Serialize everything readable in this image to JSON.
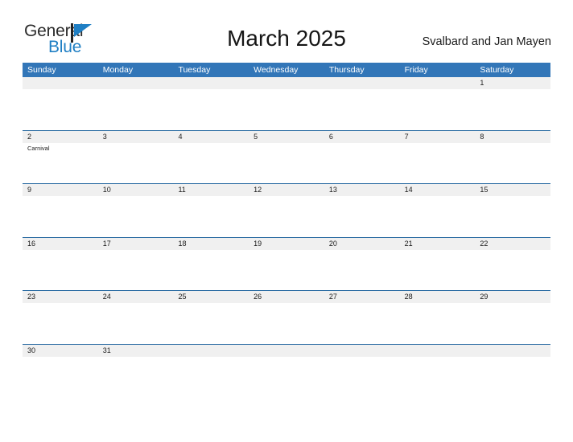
{
  "brand": {
    "name_part1": "General",
    "name_part2": "Blue",
    "flag_icon": "flag-icon",
    "accent_color": "#1f7fc4"
  },
  "header": {
    "month_title": "March 2025",
    "locale": "Svalbard and Jan Mayen"
  },
  "theme": {
    "header_blue": "#3276b8",
    "row_line_blue": "#2b6ca3",
    "number_band_gray": "#f0f0f0"
  },
  "calendar": {
    "day_headers": [
      "Sunday",
      "Monday",
      "Tuesday",
      "Wednesday",
      "Thursday",
      "Friday",
      "Saturday"
    ],
    "weeks": [
      {
        "days": [
          {
            "number": "",
            "events": []
          },
          {
            "number": "",
            "events": []
          },
          {
            "number": "",
            "events": []
          },
          {
            "number": "",
            "events": []
          },
          {
            "number": "",
            "events": []
          },
          {
            "number": "",
            "events": []
          },
          {
            "number": "1",
            "events": []
          }
        ]
      },
      {
        "days": [
          {
            "number": "2",
            "events": [
              "Carnival"
            ]
          },
          {
            "number": "3",
            "events": []
          },
          {
            "number": "4",
            "events": []
          },
          {
            "number": "5",
            "events": []
          },
          {
            "number": "6",
            "events": []
          },
          {
            "number": "7",
            "events": []
          },
          {
            "number": "8",
            "events": []
          }
        ]
      },
      {
        "days": [
          {
            "number": "9",
            "events": []
          },
          {
            "number": "10",
            "events": []
          },
          {
            "number": "11",
            "events": []
          },
          {
            "number": "12",
            "events": []
          },
          {
            "number": "13",
            "events": []
          },
          {
            "number": "14",
            "events": []
          },
          {
            "number": "15",
            "events": []
          }
        ]
      },
      {
        "days": [
          {
            "number": "16",
            "events": []
          },
          {
            "number": "17",
            "events": []
          },
          {
            "number": "18",
            "events": []
          },
          {
            "number": "19",
            "events": []
          },
          {
            "number": "20",
            "events": []
          },
          {
            "number": "21",
            "events": []
          },
          {
            "number": "22",
            "events": []
          }
        ]
      },
      {
        "days": [
          {
            "number": "23",
            "events": []
          },
          {
            "number": "24",
            "events": []
          },
          {
            "number": "25",
            "events": []
          },
          {
            "number": "26",
            "events": []
          },
          {
            "number": "27",
            "events": []
          },
          {
            "number": "28",
            "events": []
          },
          {
            "number": "29",
            "events": []
          }
        ]
      },
      {
        "days": [
          {
            "number": "30",
            "events": []
          },
          {
            "number": "31",
            "events": []
          },
          {
            "number": "",
            "events": []
          },
          {
            "number": "",
            "events": []
          },
          {
            "number": "",
            "events": []
          },
          {
            "number": "",
            "events": []
          },
          {
            "number": "",
            "events": []
          }
        ]
      }
    ]
  }
}
